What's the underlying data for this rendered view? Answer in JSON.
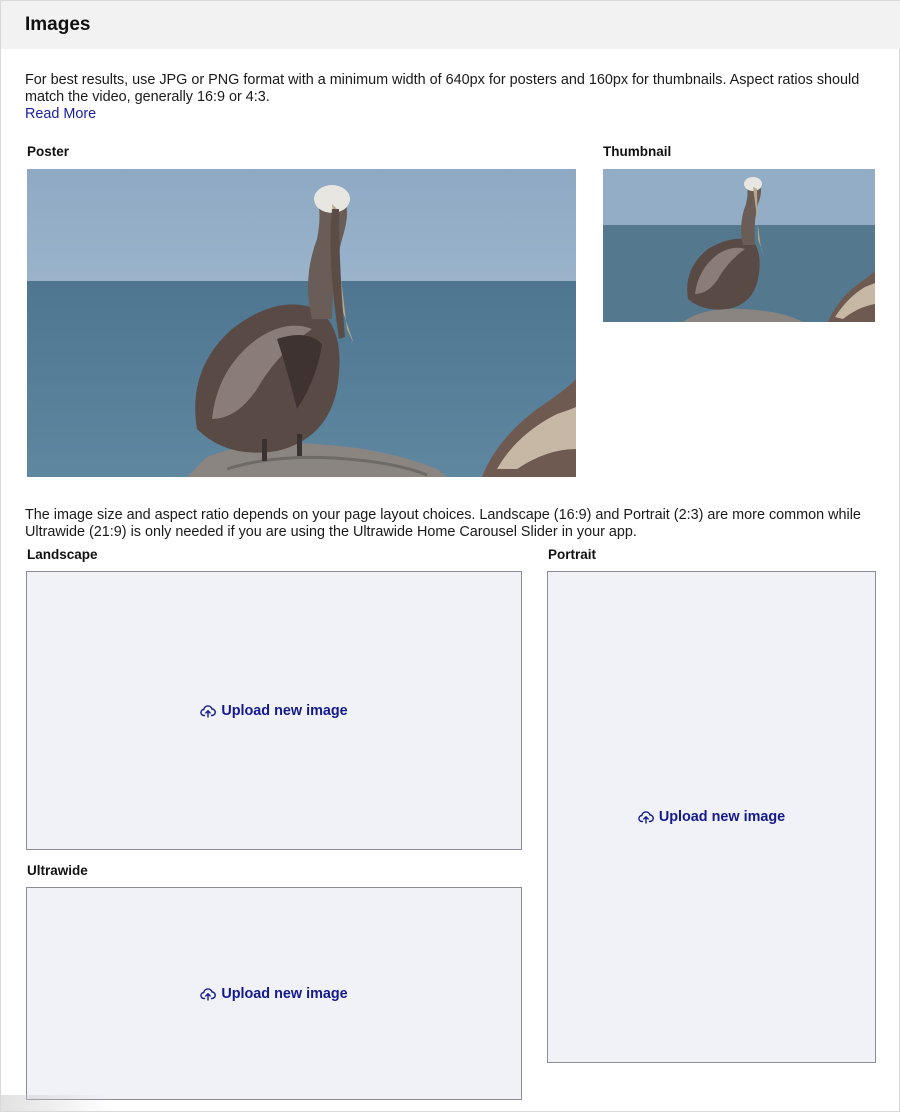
{
  "section": {
    "title": "Images"
  },
  "intro": {
    "text": "For best results, use JPG or PNG format with a minimum width of 640px for posters and 160px for thumbnails. Aspect ratios should match the video, generally 16:9 or 4:3.",
    "read_more": "Read More"
  },
  "poster": {
    "label": "Poster"
  },
  "thumbnail": {
    "label": "Thumbnail"
  },
  "layout_note": "The image size and aspect ratio depends on your page layout choices. Landscape (16:9) and Portrait (2:3) are more common while Ultrawide (21:9) is only needed if you are using the Ultrawide Home Carousel Slider in your app.",
  "landscape": {
    "label": "Landscape",
    "upload_label": "Upload new image"
  },
  "portrait": {
    "label": "Portrait",
    "upload_label": "Upload new image"
  },
  "ultrawide": {
    "label": "Ultrawide",
    "upload_label": "Upload new image"
  },
  "icons": {
    "upload": "cloud-upload-icon"
  },
  "colors": {
    "link": "#1a1f9a",
    "upload_text": "#141a8c",
    "upload_bg": "#f1f2f7",
    "header_bg": "#f2f2f2"
  }
}
